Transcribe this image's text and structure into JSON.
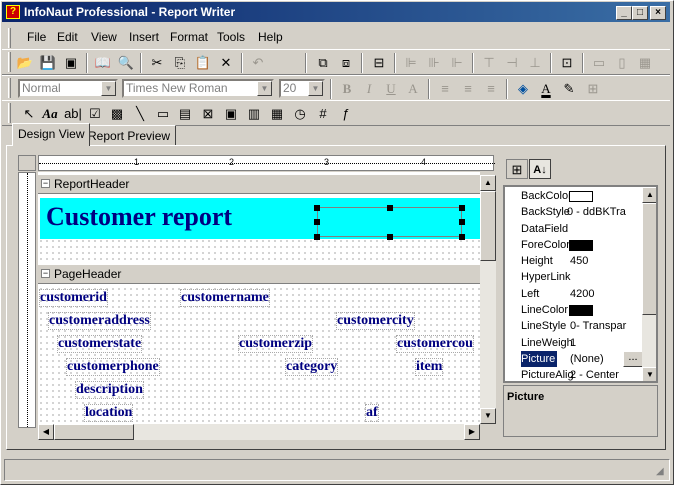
{
  "app": {
    "title": "InfoNaut Professional - Report Writer",
    "icon": "app-icon"
  },
  "window_buttons": {
    "minimize": "_",
    "maximize": "□",
    "close": "×"
  },
  "menu": [
    "File",
    "Edit",
    "View",
    "Insert",
    "Format",
    "Tools",
    "Help"
  ],
  "format_toolbar": {
    "style": "Normal",
    "font": "Times New Roman",
    "size": "20"
  },
  "tabs": [
    "Design View",
    "Report Preview"
  ],
  "ruler": {
    "marks": [
      "1",
      "2",
      "3",
      "4"
    ]
  },
  "sections": {
    "report_header": "ReportHeader",
    "page_header": "PageHeader"
  },
  "report": {
    "title": "Customer report",
    "fields": [
      "customerid",
      "customername",
      "customeraddress",
      "customercity",
      "customerstate",
      "customerzip",
      "customercou",
      "customerphone",
      "category",
      "item",
      "description",
      "location",
      "af"
    ]
  },
  "properties": {
    "rows": [
      {
        "name": "BackColor",
        "value": "",
        "swatch": "#ffffff"
      },
      {
        "name": "BackStyle",
        "value": "0 - ddBKTra"
      },
      {
        "name": "DataField",
        "value": ""
      },
      {
        "name": "ForeColor",
        "value": "",
        "swatch": "#000000"
      },
      {
        "name": "Height",
        "value": "450"
      },
      {
        "name": "HyperLink",
        "value": ""
      },
      {
        "name": "Left",
        "value": "4200"
      },
      {
        "name": "LineColor",
        "value": "",
        "swatch": "#000000"
      },
      {
        "name": "LineStyle",
        "value": "0- Transpar"
      },
      {
        "name": "LineWeigh",
        "value": "1"
      },
      {
        "name": "Picture",
        "value": "(None)",
        "selected": true
      },
      {
        "name": "PictureAlig",
        "value": "2 - Center"
      }
    ],
    "ellipsis": "...",
    "description": "Picture"
  },
  "colors": {
    "title_bg": "#0a246a",
    "header_highlight": "#00ffff",
    "field_text": "#000080",
    "selection": "#0a246a"
  }
}
